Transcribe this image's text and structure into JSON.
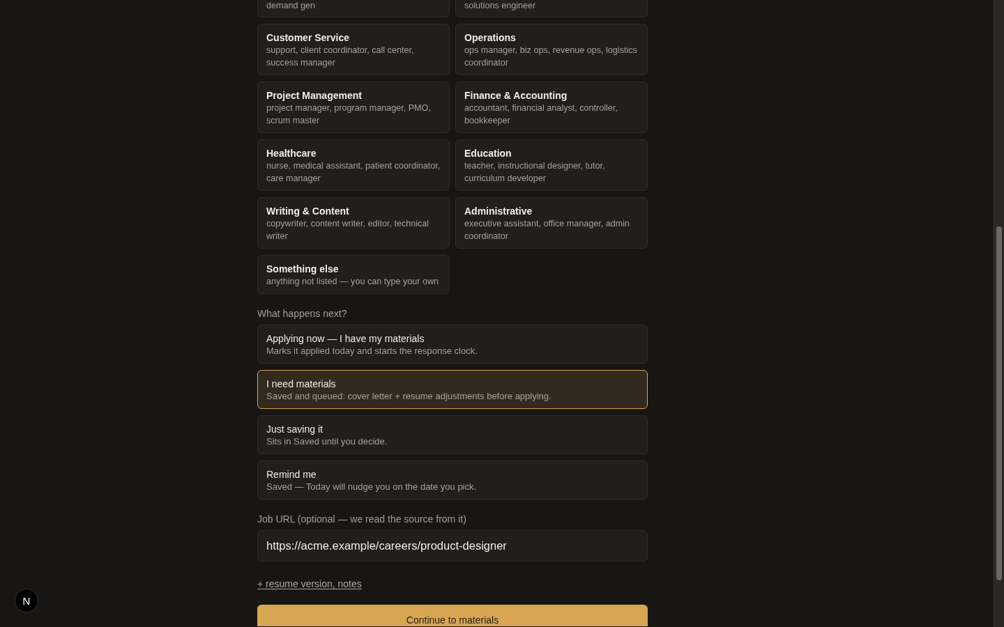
{
  "categories": [
    {
      "kind": "cut_off",
      "description": "demand gen",
      "selected": false
    },
    {
      "kind": "cut_off",
      "description": "solutions engineer",
      "selected": false
    },
    {
      "kind": "card",
      "title": "Customer Service",
      "description": "support, client coordinator, call center, success manager",
      "selected": false
    },
    {
      "kind": "card",
      "title": "Operations",
      "description": "ops manager, biz ops, revenue ops, logistics coordinator",
      "selected": false
    },
    {
      "kind": "card",
      "title": "Project Management",
      "description": "project manager, program manager, PMO, scrum master",
      "selected": false
    },
    {
      "kind": "card",
      "title": "Finance & Accounting",
      "description": "accountant, financial analyst, controller, bookkeeper",
      "selected": false
    },
    {
      "kind": "card",
      "title": "Healthcare",
      "description": "nurse, medical assistant, patient coordinator, care manager",
      "selected": false
    },
    {
      "kind": "card",
      "title": "Education",
      "description": "teacher, instructional designer, tutor, curriculum developer",
      "selected": false
    },
    {
      "kind": "card",
      "title": "Writing & Content",
      "description": "copywriter, content writer, editor, technical writer",
      "selected": false
    },
    {
      "kind": "card",
      "title": "Administrative",
      "description": "executive assistant, office manager, admin coordinator",
      "selected": false
    },
    {
      "kind": "card",
      "title": "Something else",
      "description": "anything not listed — you can type your own",
      "selected": false
    }
  ],
  "next_step": {
    "label": "What happens next?",
    "options": [
      {
        "title": "Applying now — I have my materials",
        "description": "Marks it applied today and starts the response clock.",
        "selected": false
      },
      {
        "title": "I need materials",
        "description": "Saved and queued: cover letter + resume adjustments before applying.",
        "selected": true
      },
      {
        "title": "Just saving it",
        "description": "Sits in Saved until you decide.",
        "selected": false
      },
      {
        "title": "Remind me",
        "description": "Saved — Today will nudge you on the date you pick.",
        "selected": false
      }
    ]
  },
  "job_url": {
    "label": "Job URL (optional — we read the source from it)",
    "value": "https://acme.example/careers/product-designer"
  },
  "more_fields_link": "+ resume version, notes",
  "continue_button": "Continue to materials",
  "dev_indicator": "N"
}
